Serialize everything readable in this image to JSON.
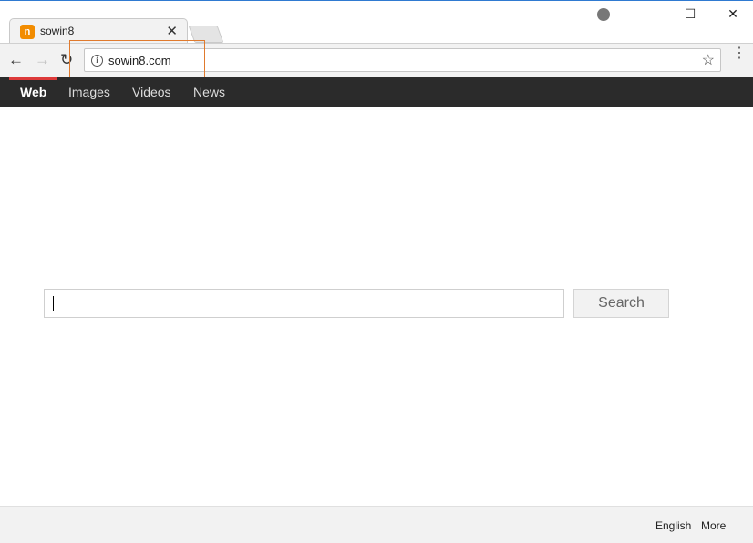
{
  "browser": {
    "tab": {
      "title": "sowin8",
      "favicon_letter": "n",
      "close_glyph": "✕"
    },
    "window_controls": {
      "minimize": "—",
      "maximize": "☐",
      "close": "✕"
    },
    "toolbar": {
      "back": "←",
      "forward": "→",
      "reload": "↻",
      "menu": "⋮"
    },
    "omnibox": {
      "info_glyph": "i",
      "url": "sowin8.com",
      "star": "☆"
    },
    "highlight_color": "#e07a2d"
  },
  "nav": {
    "items": [
      {
        "label": "Web",
        "active": true
      },
      {
        "label": "Images",
        "active": false
      },
      {
        "label": "Videos",
        "active": false
      },
      {
        "label": "News",
        "active": false
      }
    ],
    "active_color": "#dd3a3a"
  },
  "search": {
    "value": "",
    "button_label": "Search"
  },
  "footer": {
    "language": "English",
    "more": "More"
  }
}
